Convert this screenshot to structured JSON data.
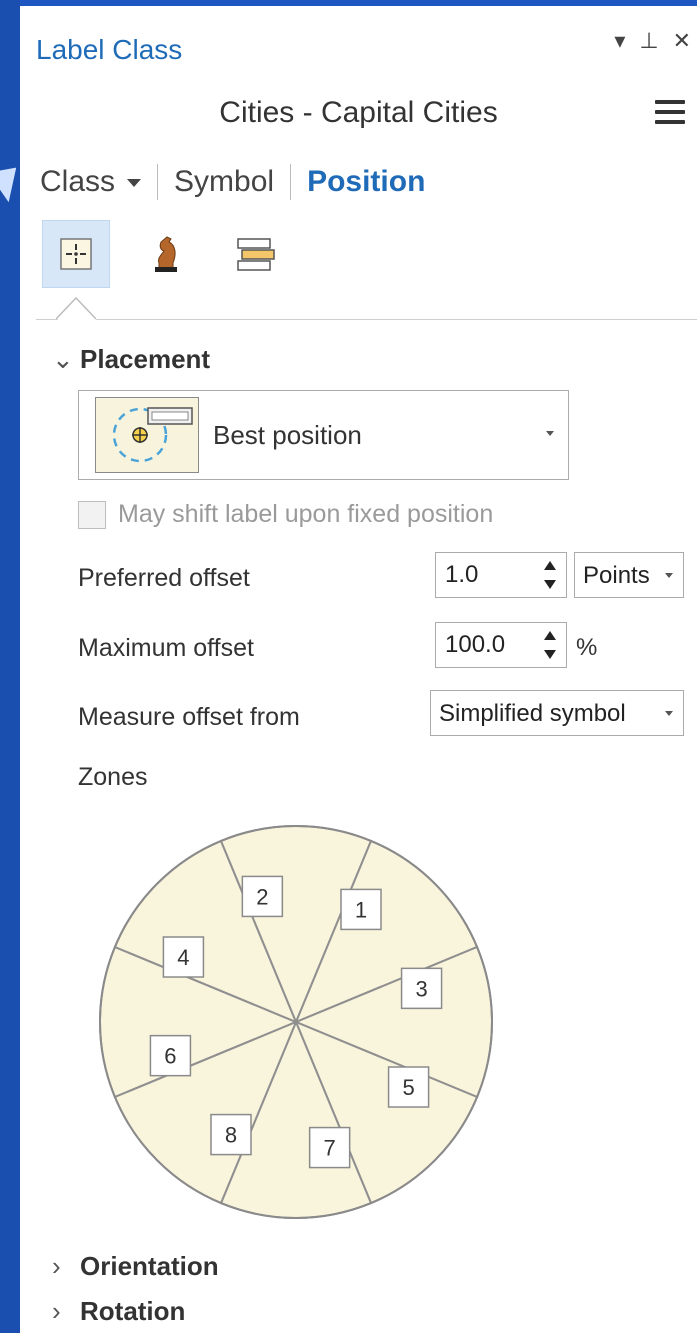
{
  "panel": {
    "title": "Label Class",
    "controls": {
      "dropdown": "▾",
      "pin": "⊥",
      "close": "✕"
    }
  },
  "layer": {
    "title": "Cities - Capital Cities"
  },
  "tabs": [
    {
      "label": "Class",
      "selected": false,
      "has_dropdown": true
    },
    {
      "label": "Symbol",
      "selected": false
    },
    {
      "label": "Position",
      "selected": true
    }
  ],
  "subtabs": [
    {
      "name": "placement-icon",
      "selected": true
    },
    {
      "name": "conflict-resolution-icon",
      "selected": false
    },
    {
      "name": "label-fitting-icon",
      "selected": false
    }
  ],
  "sections": {
    "placement": {
      "title": "Placement",
      "expanded": true
    },
    "orientation": {
      "title": "Orientation",
      "expanded": false
    },
    "rotation": {
      "title": "Rotation",
      "expanded": false
    }
  },
  "placement": {
    "value": "Best position",
    "may_shift": {
      "label": "May shift label upon fixed position",
      "checked": false,
      "enabled": false
    },
    "preferred_offset": {
      "label": "Preferred offset",
      "value": "1.0",
      "unit": "Points"
    },
    "maximum_offset": {
      "label": "Maximum offset",
      "value": "100.0",
      "unit": "%"
    },
    "measure_from": {
      "label": "Measure offset from",
      "value": "Simplified symbol"
    },
    "zones": {
      "label": "Zones",
      "wedges": [
        "2",
        "1",
        "3",
        "5",
        "7",
        "8",
        "6",
        "4"
      ]
    }
  },
  "colors": {
    "accent": "#1f6bb8",
    "zone_fill": "#f9f4dc",
    "selected_subtab": "#d7e7f7",
    "desktop": "#1a4fb0"
  }
}
